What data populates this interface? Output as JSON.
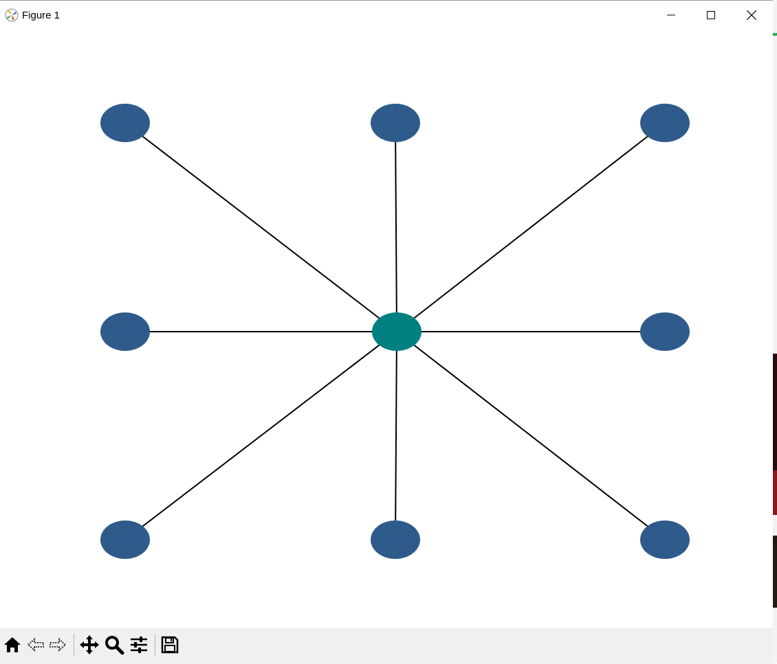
{
  "window": {
    "title": "Figure 1"
  },
  "graph": {
    "center_color": "#008080",
    "node_color": "#2e5b8c",
    "edge_color": "#000000",
    "nodes": [
      {
        "id": "center",
        "col": 1,
        "row": 1
      },
      {
        "id": "top-left",
        "col": 0,
        "row": 0
      },
      {
        "id": "top-center",
        "col": 1,
        "row": 0
      },
      {
        "id": "top-right",
        "col": 2,
        "row": 0
      },
      {
        "id": "middle-left",
        "col": 0,
        "row": 1
      },
      {
        "id": "middle-right",
        "col": 2,
        "row": 1
      },
      {
        "id": "bottom-left",
        "col": 0,
        "row": 2
      },
      {
        "id": "bottom-center",
        "col": 1,
        "row": 2
      },
      {
        "id": "bottom-right",
        "col": 2,
        "row": 2
      }
    ],
    "edges": [
      [
        "center",
        "top-left"
      ],
      [
        "center",
        "top-center"
      ],
      [
        "center",
        "top-right"
      ],
      [
        "center",
        "middle-left"
      ],
      [
        "center",
        "middle-right"
      ],
      [
        "center",
        "bottom-left"
      ],
      [
        "center",
        "bottom-center"
      ],
      [
        "center",
        "bottom-right"
      ]
    ]
  },
  "toolbar": {
    "tools": [
      "home-icon",
      "back-icon",
      "forward-icon",
      "pan-icon",
      "zoom-icon",
      "configure-subplots-icon",
      "save-icon"
    ]
  }
}
